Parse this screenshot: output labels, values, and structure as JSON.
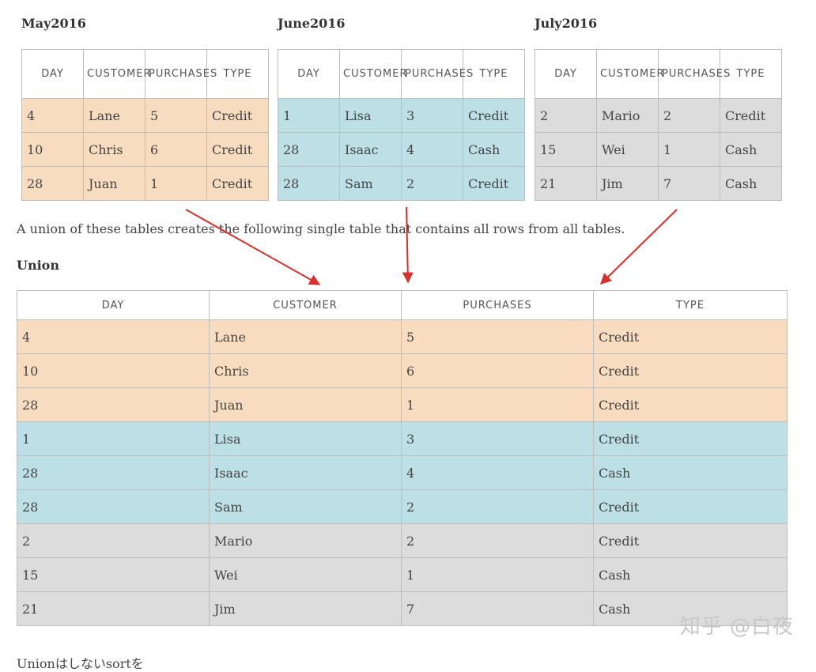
{
  "tables": [
    {
      "title": "May2016",
      "headers": [
        "DAY",
        "CUSTOMER",
        "PURCHASES",
        "TYPE"
      ],
      "rows": [
        [
          "4",
          "Lane",
          "5",
          "Credit"
        ],
        [
          "10",
          "Chris",
          "6",
          "Credit"
        ],
        [
          "28",
          "Juan",
          "1",
          "Credit"
        ]
      ],
      "color": "#f8dcbf"
    },
    {
      "title": "June2016",
      "headers": [
        "DAY",
        "CUSTOMER",
        "PURCHASES",
        "TYPE"
      ],
      "rows": [
        [
          "1",
          "Lisa",
          "3",
          "Credit"
        ],
        [
          "28",
          "Isaac",
          "4",
          "Cash"
        ],
        [
          "28",
          "Sam",
          "2",
          "Credit"
        ]
      ],
      "color": "#bddfe6"
    },
    {
      "title": "July2016",
      "headers": [
        "DAY",
        "CUSTOMER",
        "PURCHASES",
        "TYPE"
      ],
      "rows": [
        [
          "2",
          "Mario",
          "2",
          "Credit"
        ],
        [
          "15",
          "Wei",
          "1",
          "Cash"
        ],
        [
          "21",
          "Jim",
          "7",
          "Cash"
        ]
      ],
      "color": "#dcdcdc"
    }
  ],
  "paragraph": "A union of these tables creates the following single table that contains all rows from all tables.",
  "union": {
    "title": "Union",
    "headers": [
      "DAY",
      "CUSTOMER",
      "PURCHASES",
      "TYPE"
    ],
    "rows": [
      {
        "cells": [
          "4",
          "Lane",
          "5",
          "Credit"
        ],
        "group": "orange"
      },
      {
        "cells": [
          "10",
          "Chris",
          "6",
          "Credit"
        ],
        "group": "orange"
      },
      {
        "cells": [
          "28",
          "Juan",
          "1",
          "Credit"
        ],
        "group": "orange"
      },
      {
        "cells": [
          "1",
          "Lisa",
          "3",
          "Credit"
        ],
        "group": "blue"
      },
      {
        "cells": [
          "28",
          "Isaac",
          "4",
          "Cash"
        ],
        "group": "blue"
      },
      {
        "cells": [
          "28",
          "Sam",
          "2",
          "Credit"
        ],
        "group": "blue"
      },
      {
        "cells": [
          "2",
          "Mario",
          "2",
          "Credit"
        ],
        "group": "gray"
      },
      {
        "cells": [
          "15",
          "Wei",
          "1",
          "Cash"
        ],
        "group": "gray"
      },
      {
        "cells": [
          "21",
          "Jim",
          "7",
          "Cash"
        ],
        "group": "gray"
      }
    ]
  },
  "arrow_color": "#d9302c",
  "watermark": "知乎 @白夜",
  "cutoff_text": "Unionはしないsortを"
}
